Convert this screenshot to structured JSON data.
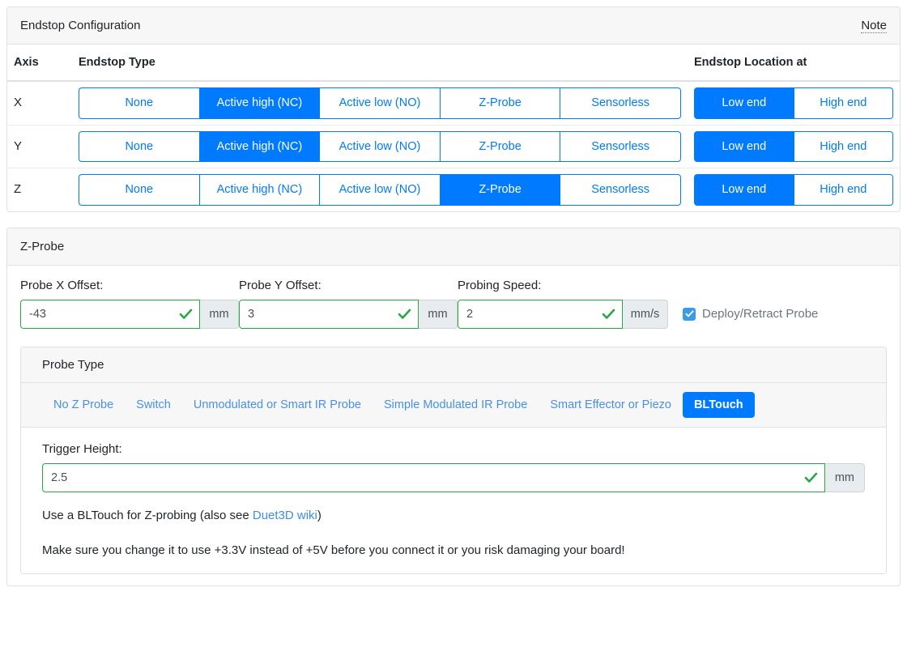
{
  "endstop_card": {
    "title": "Endstop Configuration",
    "note_label": "Note",
    "columns": {
      "axis": "Axis",
      "endstop_type": "Endstop Type",
      "endstop_location": "Endstop Location at"
    },
    "type_options": [
      "None",
      "Active high (NC)",
      "Active low (NO)",
      "Z-Probe",
      "Sensorless"
    ],
    "location_options": [
      "Low end",
      "High end"
    ],
    "rows": [
      {
        "axis": "X",
        "selected_type": "Active high (NC)",
        "selected_location": "Low end"
      },
      {
        "axis": "Y",
        "selected_type": "Active high (NC)",
        "selected_location": "Low end"
      },
      {
        "axis": "Z",
        "selected_type": "Z-Probe",
        "selected_location": "Low end"
      }
    ]
  },
  "zprobe_card": {
    "title": "Z-Probe",
    "probe_x_offset": {
      "label": "Probe X Offset:",
      "value": "-43",
      "unit": "mm"
    },
    "probe_y_offset": {
      "label": "Probe Y Offset:",
      "value": "3",
      "unit": "mm"
    },
    "probing_speed": {
      "label": "Probing Speed:",
      "value": "2",
      "unit": "mm/s"
    },
    "deploy_retract": {
      "label": "Deploy/Retract Probe",
      "checked": true
    },
    "probe_type": {
      "title": "Probe Type",
      "options": [
        "No Z Probe",
        "Switch",
        "Unmodulated or Smart IR Probe",
        "Simple Modulated IR Probe",
        "Smart Effector or Piezo",
        "BLTouch"
      ],
      "selected": "BLTouch"
    },
    "trigger_height": {
      "label": "Trigger Height:",
      "value": "2.5",
      "unit": "mm"
    },
    "description_prefix": "Use a BLTouch for Z-probing (also see ",
    "description_link": "Duet3D wiki",
    "description_suffix": ")",
    "warning": "Make sure you change it to use +3.3V instead of +5V before you connect it or you risk damaging your board!"
  },
  "colors": {
    "primary": "#007bff",
    "valid": "#28a745",
    "link": "#3a8ee6",
    "header_bg": "#f7f7f8",
    "border": "#dee2e6"
  }
}
